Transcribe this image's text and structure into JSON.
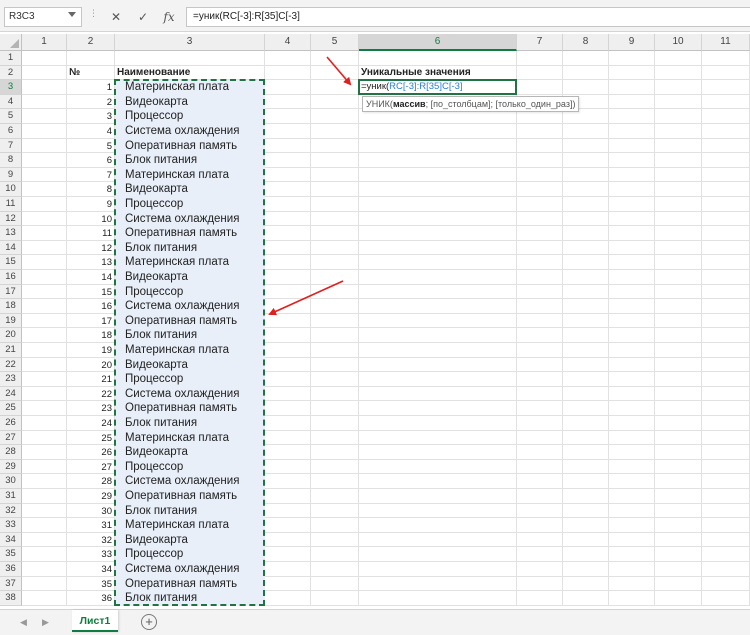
{
  "formula_bar": {
    "name_box": "R3C3",
    "cancel_icon": "✕",
    "enter_icon": "✓",
    "fx_label": "fx",
    "formula": "=уник(RC[-3]:R[35]C[-3]"
  },
  "columns": [
    "1",
    "2",
    "3",
    "4",
    "5",
    "6",
    "7",
    "8",
    "9",
    "10",
    "11"
  ],
  "selected_column": "6",
  "selected_row": "3",
  "rows": [
    "1",
    "2",
    "3",
    "4",
    "5",
    "6",
    "7",
    "8",
    "9",
    "10",
    "11",
    "12",
    "13",
    "14",
    "15",
    "16",
    "17",
    "18",
    "19",
    "20",
    "21",
    "22",
    "23",
    "24",
    "25",
    "26",
    "27",
    "28",
    "29",
    "30",
    "31",
    "32",
    "33",
    "34",
    "35",
    "36",
    "37",
    "38"
  ],
  "table": {
    "header_num": "№",
    "header_name": "Наименование",
    "numbers": [
      "1",
      "2",
      "3",
      "4",
      "5",
      "6",
      "7",
      "8",
      "9",
      "10",
      "11",
      "12",
      "13",
      "14",
      "15",
      "16",
      "17",
      "18",
      "19",
      "20",
      "21",
      "22",
      "23",
      "24",
      "25",
      "26",
      "27",
      "28",
      "29",
      "30",
      "31",
      "32",
      "33",
      "34",
      "35",
      "36"
    ],
    "names": [
      "Материнская плата",
      "Видеокарта",
      "Процессор",
      "Система охлаждения",
      "Оперативная память",
      "Блок питания",
      "Материнская плата",
      "Видеокарта",
      "Процессор",
      "Система охлаждения",
      "Оперативная память",
      "Блок питания",
      "Материнская плата",
      "Видеокарта",
      "Процессор",
      "Система охлаждения",
      "Оперативная память",
      "Блок питания",
      "Материнская плата",
      "Видеокарта",
      "Процессор",
      "Система охлаждения",
      "Оперативная память",
      "Блок питания",
      "Материнская плата",
      "Видеокарта",
      "Процессор",
      "Система охлаждения",
      "Оперативная память",
      "Блок питания",
      "Материнская плата",
      "Видеокарта",
      "Процессор",
      "Система охлаждения",
      "Оперативная память",
      "Блок питания"
    ]
  },
  "unique_header": "Уникальные значения",
  "active_cell": {
    "prefix": "=уник(",
    "refs": "RC[-3]:R[35]C[-3]"
  },
  "tooltip": {
    "func": "УНИК(",
    "arg1": "массив",
    "rest": "; [по_столбцам]; [только_один_раз])"
  },
  "sheet": {
    "tab_label": "Лист1",
    "add_icon": "⊕"
  },
  "colors": {
    "accent_green": "#217346",
    "arrow_red": "#e02020",
    "ref_blue": "#2a7fd0"
  }
}
